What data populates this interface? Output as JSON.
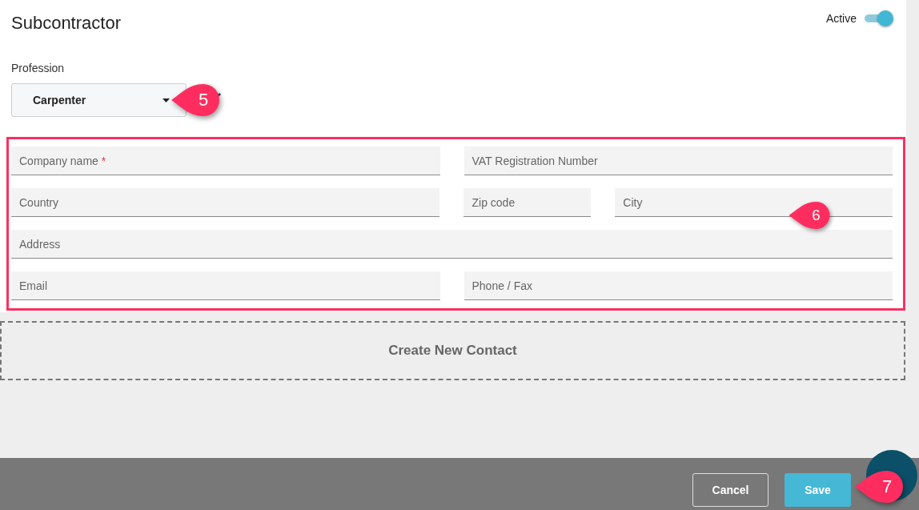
{
  "header": {
    "title": "Subcontractor",
    "active": {
      "label": "Active",
      "on": true
    }
  },
  "profession": {
    "label": "Profession",
    "value": "Carpenter",
    "callout": "5"
  },
  "form": {
    "callout": "6",
    "rows": [
      [
        {
          "label": "Company name",
          "required_mark": "*"
        },
        {
          "label": "VAT Registration Number"
        }
      ],
      [
        {
          "label": "Country"
        },
        {
          "label": "Zip code"
        },
        {
          "label": "City"
        }
      ],
      [
        {
          "label": "Address"
        }
      ],
      [
        {
          "label": "Email"
        },
        {
          "label": "Phone / Fax"
        }
      ]
    ]
  },
  "create_contact": "Create New Contact",
  "footer": {
    "buttons": [
      {
        "label": "Cancel",
        "kind": "secondary"
      },
      {
        "label": "Save",
        "kind": "primary"
      }
    ],
    "callout": "7"
  }
}
